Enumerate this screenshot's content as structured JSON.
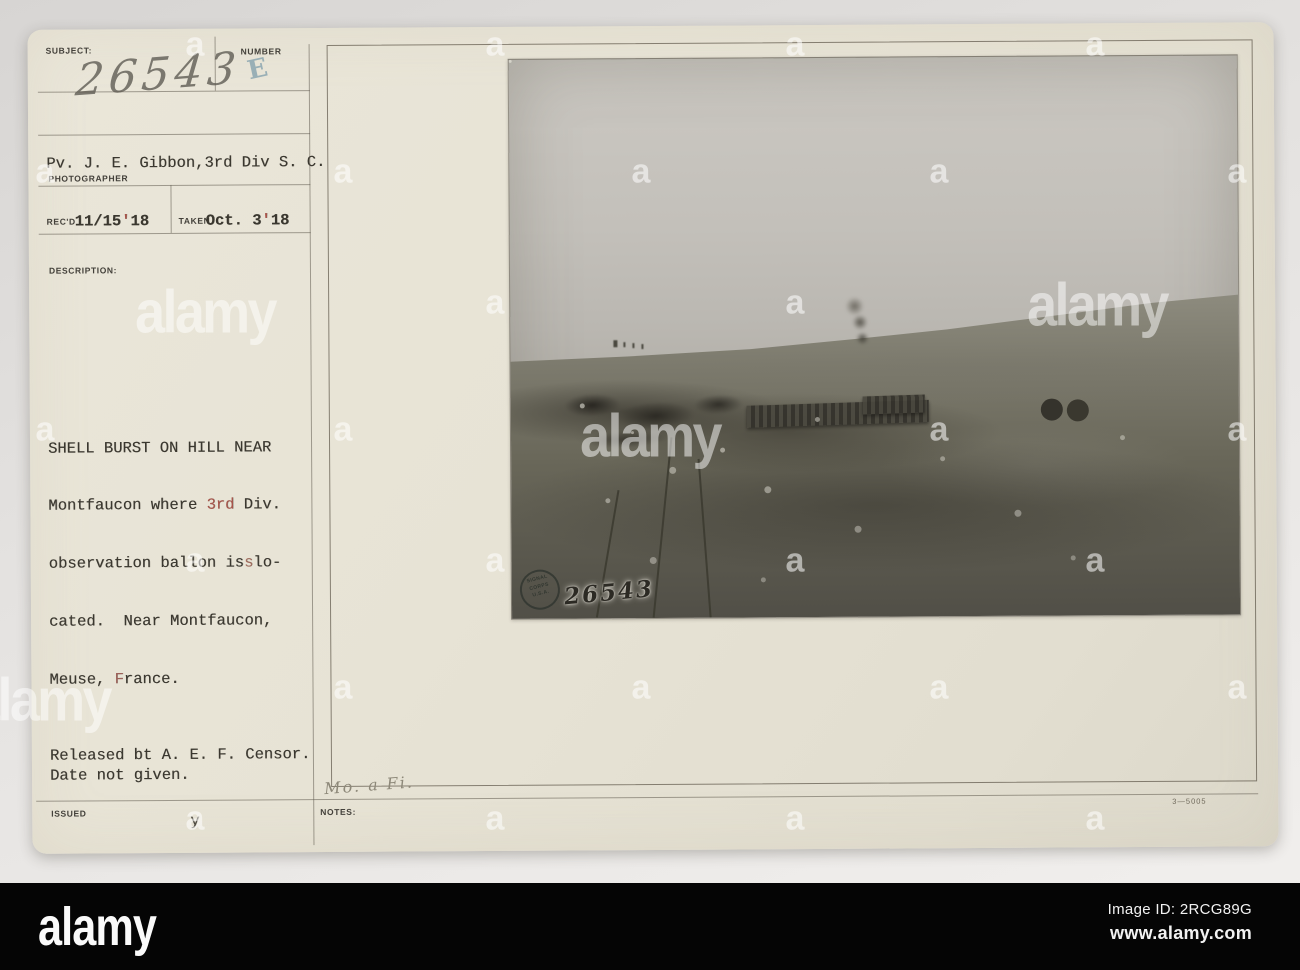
{
  "card": {
    "subject_label": "SUBJECT:",
    "subject_number": "26543",
    "number_label": "NUMBER",
    "number_stamp": "E",
    "photographer_name": "Pv. J. E. Gibbon,3rd Div S. C.",
    "photographer_label": "PHOTOGRAPHER",
    "received_label": "REC'D",
    "received_date_a": "11/15",
    "received_date_b": "'",
    "received_date_c": "18",
    "taken_label": "TAKEN",
    "taken_date_a": "Oct. 3",
    "taken_date_b": "'",
    "taken_date_c": "18",
    "description_label": "DESCRIPTION:",
    "desc_line1": "SHELL BURST ON HILL NEAR",
    "desc_line2a": "Montfaucon where ",
    "desc_line2b": "3rd",
    "desc_line2c": " Div.",
    "desc_line3a": "observation ballon is",
    "desc_line3b": "s",
    "desc_line3c": " lo-",
    "desc_line4": "cated.  Near Montfaucon,",
    "desc_line5a": "Meuse, ",
    "desc_line5b": "F",
    "desc_line5c": "rance.",
    "released_line1": "Released bt A. E. F. Censor.",
    "released_line2": "Date not given.",
    "issued_label": "ISSUED",
    "issued_mark": "y",
    "notes_label": "NOTES:",
    "notes_handwriting": "Mo. a Fi.",
    "form_number": "3—5005"
  },
  "photo": {
    "stamp_line1": "SIGNAL",
    "stamp_line2": "CORPS",
    "stamp_line3": "U.S.A.",
    "photo_number": "26543"
  },
  "watermark": {
    "brand": "alamy",
    "small_mark": "a"
  },
  "footer": {
    "brand": "alamy",
    "image_id_text": "Image ID: 2RCG89G",
    "url": "www.alamy.com"
  },
  "colors": {
    "card_paper": "#e7e3d5",
    "footer_bar": "#050505",
    "typed_ink": "#3a372f",
    "accent_red": "#a8544a",
    "stamp_blue": "#8ba6b0"
  }
}
